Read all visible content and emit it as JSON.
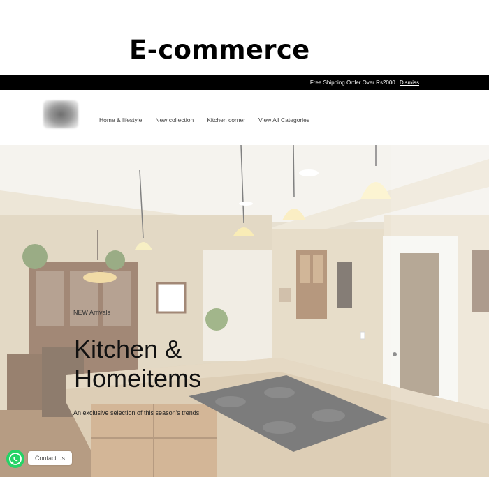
{
  "page_heading": "E-commerce",
  "announcement": {
    "text": "Free Shipping Order Over Rs2000",
    "dismiss_label": "Dismiss"
  },
  "nav": {
    "items": [
      {
        "label": "Home & lifestyle"
      },
      {
        "label": "New collection"
      },
      {
        "label": "Kitchen corner"
      },
      {
        "label": "View All Categories"
      }
    ]
  },
  "hero": {
    "eyebrow": "NEW Arrivals",
    "title_line1": "Kitchen &",
    "title_line2": "Homeitems",
    "subtitle": "An exclusive selection of this season's trends."
  },
  "chat": {
    "icon": "whatsapp-icon",
    "label": "Contact us"
  },
  "colors": {
    "announce_bar": "#000000",
    "whatsapp": "#25d366"
  }
}
